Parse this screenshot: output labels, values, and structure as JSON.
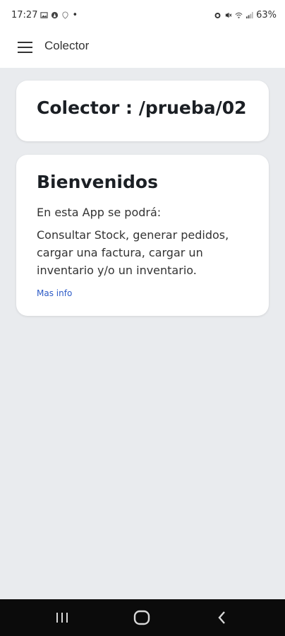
{
  "status_bar": {
    "time": "17:27",
    "left_icons": [
      "gallery-icon",
      "app-icon",
      "location-icon"
    ],
    "dot": "•",
    "battery": "63%",
    "right_icons": [
      "alarm-icon",
      "mute-icon",
      "wifi-icon",
      "signal-icon"
    ]
  },
  "app_bar": {
    "title": "Colector",
    "menu_icon": "hamburger-menu-icon"
  },
  "card1": {
    "title": "Colector : /prueba/02"
  },
  "card2": {
    "title": "Bienvenidos",
    "subtitle": "En esta App se podrá:",
    "body": "Consultar Stock, generar pedidos, cargar una factura, cargar un inventario y/o un inventario.",
    "link": "Mas info"
  },
  "colors": {
    "background": "#e9ebee",
    "card": "#ffffff",
    "link": "#2d5bc7",
    "nav_bar": "#0b0b0b"
  },
  "nav_bar": {
    "buttons": [
      "recents-icon",
      "home-icon",
      "back-icon"
    ]
  }
}
